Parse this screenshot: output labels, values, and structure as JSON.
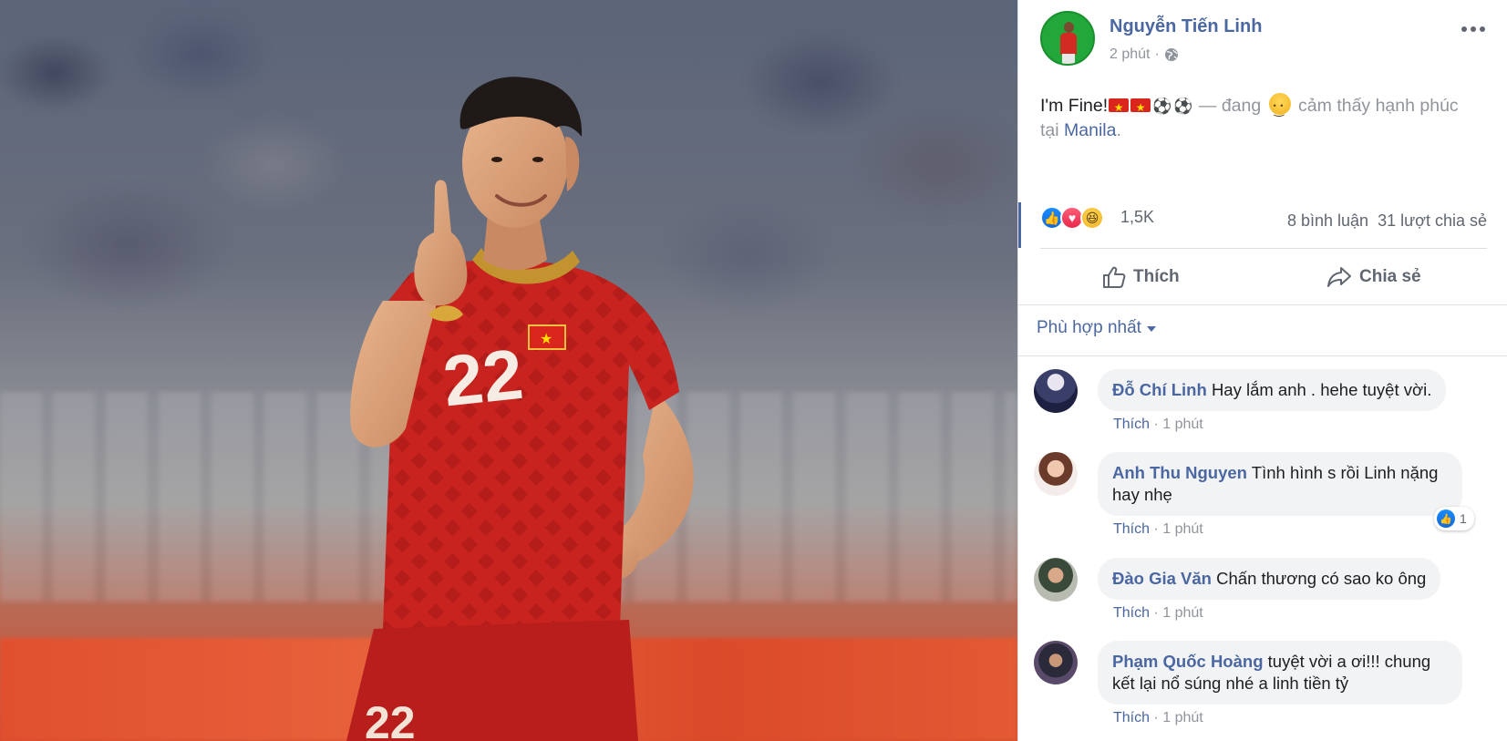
{
  "post": {
    "author": "Nguyễn Tiến Linh",
    "time": "2 phút",
    "separator": "·",
    "text_main": "I'm Fine!",
    "text_feeling_prefix": " — đang ",
    "text_feeling": " cảm thấy hạnh phúc tại ",
    "location": "Manila",
    "text_end": ".",
    "emoji": [
      "vietnam-flag",
      "vietnam-flag",
      "soccer-ball",
      "soccer-ball",
      "smiley"
    ],
    "jersey_number": "22"
  },
  "reactions": {
    "count": "1,5K",
    "types": [
      "like",
      "love",
      "haha"
    ],
    "comments": "8 bình luận",
    "shares": "31 lượt chia sẻ"
  },
  "actions": {
    "like": "Thích",
    "share": "Chia sẻ"
  },
  "sort": {
    "label": "Phù hợp nhất"
  },
  "comments": [
    {
      "name": "Đỗ Chí Linh",
      "text": "Hay lắm anh . hehe tuyệt vời.",
      "like": "Thích",
      "time": "1 phút",
      "sep": " · "
    },
    {
      "name": "Anh Thu Nguyen",
      "text": "Tình hình s rồi Linh nặng hay nhẹ",
      "like": "Thích",
      "time": "1 phút",
      "sep": " · ",
      "likes": "1"
    },
    {
      "name": "Đào Gia Văn",
      "text": "Chấn thương có sao ko ông",
      "like": "Thích",
      "time": "1 phút",
      "sep": " · "
    },
    {
      "name": "Phạm Quốc Hoàng",
      "text": "tuyệt vời a ơi!!! chung kết lại nổ súng nhé a linh tiền tỷ",
      "like": "Thích",
      "time": "1 phút",
      "sep": " · "
    }
  ],
  "colors": {
    "link": "#4b67a1",
    "muted": "#90949c",
    "bubble": "#f2f3f5",
    "jersey": "#c8231f"
  }
}
